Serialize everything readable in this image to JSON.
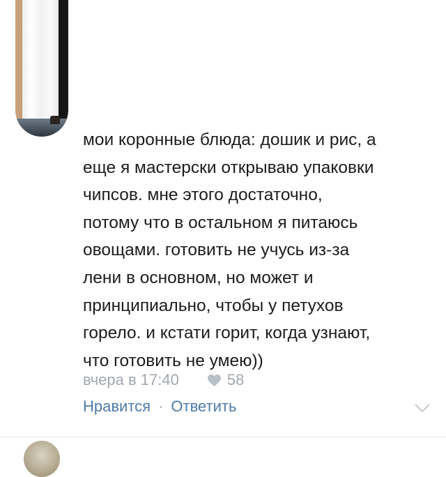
{
  "comment": {
    "text": "мои коронные блюда: дошик и рис, а\nеще я мастерски открываю упаковки\nчипсов. мне этого достаточно,\nпотому что в остальном я питаюсь\nовощами. готовить не учусь из-за\nлени в основном, но может и\nпринципиально, чтобы у петухов\nгорело. и кстати горит, когда узнают,\nчто готовить не умею))",
    "timestamp": "вчера в 17:40",
    "likes_count": "58"
  },
  "actions": {
    "like_label": "Нравится",
    "separator": "·",
    "reply_label": "Ответить"
  },
  "icons": {
    "like": "heart-icon",
    "more": "chevron-down-icon"
  },
  "colors": {
    "text": "#1c1c1c",
    "meta": "#a2a8ae",
    "link": "#4e7aa8"
  }
}
